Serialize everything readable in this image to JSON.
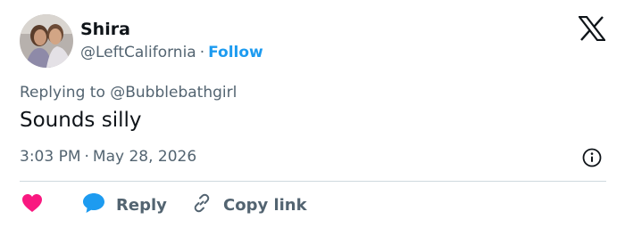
{
  "author": {
    "name": "Shira",
    "handle": "@LeftCalifornia",
    "separator": "·",
    "follow_label": "Follow"
  },
  "tweet": {
    "replying_prefix": "Replying to",
    "replying_to": "@Bubblebathgirl",
    "text": "Sounds silly",
    "time": "3:03 PM",
    "date": "May 28, 2026",
    "separator": "·"
  },
  "actions": {
    "reply_label": "Reply",
    "copy_link_label": "Copy link"
  },
  "colors": {
    "accent": "#1d9bf0",
    "like": "#f91880",
    "muted": "#536471",
    "text": "#0f1419"
  },
  "icons": {
    "brand": "x-logo-icon",
    "like": "heart-icon",
    "reply": "speech-bubble-icon",
    "copy": "link-icon",
    "info": "info-icon"
  }
}
